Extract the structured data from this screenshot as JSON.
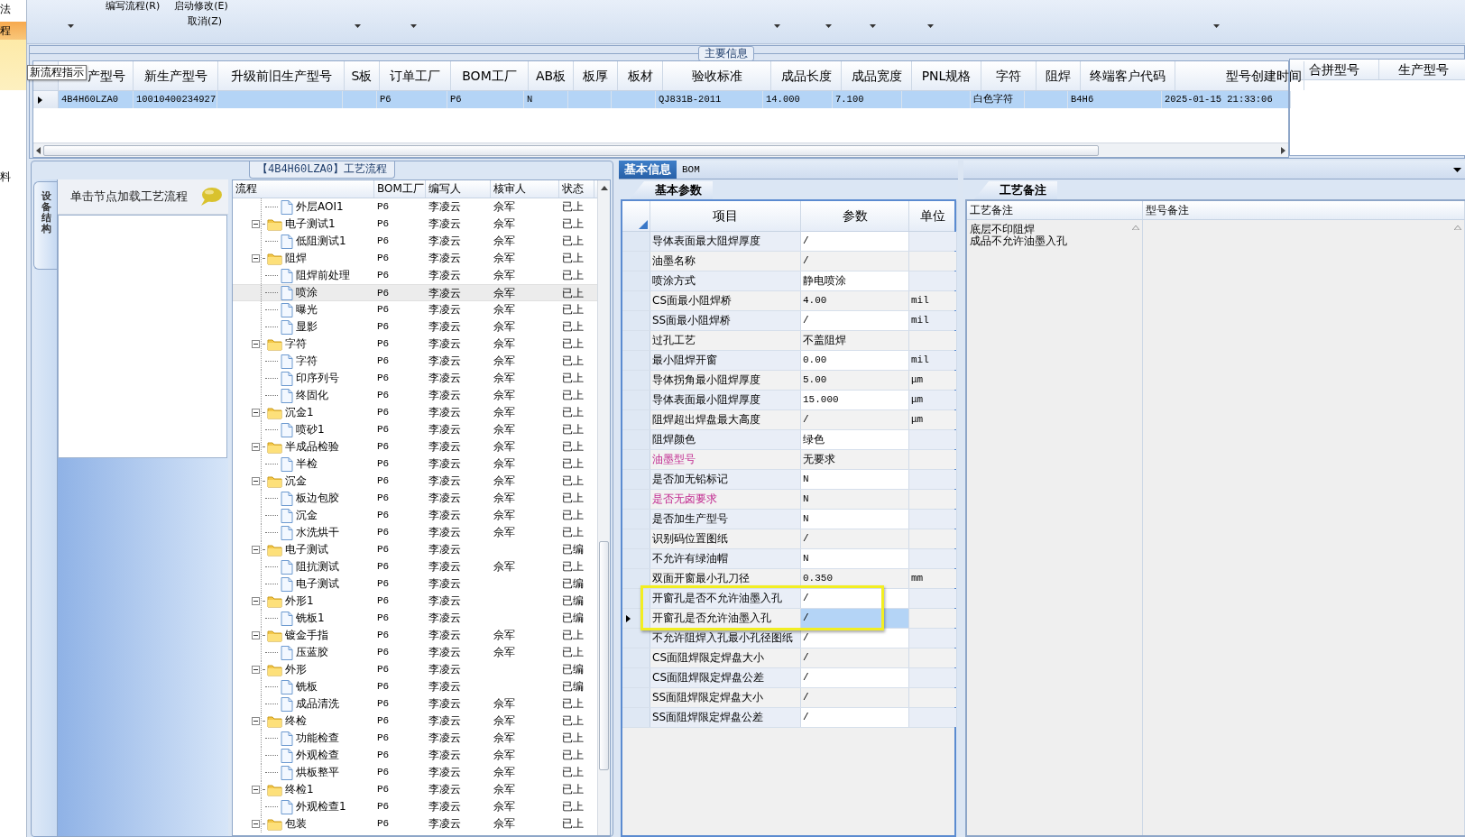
{
  "side_menu": {
    "items": [
      {
        "label": "法",
        "selected": false
      },
      {
        "label": "程",
        "selected": true
      },
      {
        "label": "料",
        "selected": false
      }
    ]
  },
  "toolbar": {
    "items": [
      "编写流程(R)",
      "启动修改(E)"
    ],
    "second_row": [
      "取消(Z)"
    ]
  },
  "main_info": {
    "title": "主要信息",
    "tooltip": "新流程指示",
    "columns": [
      {
        "header": "产型号",
        "value": "4B4H60LZA0"
      },
      {
        "header": "新生产型号",
        "value": "10010400234927"
      },
      {
        "header": "升级前旧生产型号"
      },
      {
        "header": "S板"
      },
      {
        "header": "订单工厂",
        "value": "P6"
      },
      {
        "header": "BOM工厂",
        "value": "P6"
      },
      {
        "header": "AB板",
        "value": "N"
      },
      {
        "header": "板厚"
      },
      {
        "header": "板材"
      },
      {
        "header": "验收标准",
        "value": "QJ831B-2011"
      },
      {
        "header": "成品长度",
        "value": "14.000"
      },
      {
        "header": "成品宽度",
        "value": "7.100"
      },
      {
        "header": "PNL规格"
      },
      {
        "header": "字符",
        "value": "白色字符"
      },
      {
        "header": "阻焊"
      },
      {
        "header": "终端客户代码",
        "value": "B4H6"
      },
      {
        "header": "型号创建时间",
        "value": "2025-01-15 21:33:06"
      }
    ],
    "row_selected": true,
    "side_columns": [
      "合拼型号",
      "生产型号"
    ]
  },
  "process": {
    "title": "【4B4H60LZA0】工艺流程",
    "nav": {
      "tab": {
        "label": "设备结构",
        "selected": true
      },
      "hint": "单击节点加载工艺流程"
    },
    "tree": {
      "columns": [
        "流程",
        "BOM工厂",
        "编写人",
        "核审人",
        "状态"
      ],
      "nodes": [
        {
          "children": [
            {
              "kind": "step",
              "name": "外层AOI1",
              "bom": "P6",
              "writer": "李凌云",
              "reviewer": "佘军",
              "status": "已上",
              "selected": false
            }
          ]
        },
        {
          "kind": "folder",
          "name": "电子测试1",
          "bom": "P6",
          "writer": "李凌云",
          "reviewer": "佘军",
          "status": "已上",
          "selected": false,
          "expanded": true,
          "children": [
            {
              "kind": "step",
              "name": "低阻测试1",
              "bom": "P6",
              "writer": "李凌云",
              "reviewer": "佘军",
              "status": "已上",
              "selected": false
            }
          ]
        },
        {
          "kind": "folder",
          "name": "阻焊",
          "bom": "P6",
          "writer": "李凌云",
          "reviewer": "佘军",
          "status": "已上",
          "selected": false,
          "expanded": true,
          "children": [
            {
              "kind": "step",
              "name": "阻焊前处理",
              "bom": "P6",
              "writer": "李凌云",
              "reviewer": "佘军",
              "status": "已上",
              "selected": false
            },
            {
              "kind": "step",
              "name": "喷涂",
              "bom": "P6",
              "writer": "李凌云",
              "reviewer": "佘军",
              "status": "已上",
              "selected": true
            },
            {
              "kind": "step",
              "name": "曝光",
              "bom": "P6",
              "writer": "李凌云",
              "reviewer": "佘军",
              "status": "已上",
              "selected": false
            },
            {
              "kind": "step",
              "name": "显影",
              "bom": "P6",
              "writer": "李凌云",
              "reviewer": "佘军",
              "status": "已上",
              "selected": false
            }
          ]
        },
        {
          "kind": "folder",
          "name": "字符",
          "bom": "P6",
          "writer": "李凌云",
          "reviewer": "佘军",
          "status": "已上",
          "selected": false,
          "expanded": true,
          "children": [
            {
              "kind": "step",
              "name": "字符",
              "bom": "P6",
              "writer": "李凌云",
              "reviewer": "佘军",
              "status": "已上",
              "selected": false
            },
            {
              "kind": "step",
              "name": "印序列号",
              "bom": "P6",
              "writer": "李凌云",
              "reviewer": "佘军",
              "status": "已上",
              "selected": false
            },
            {
              "kind": "step",
              "name": "终固化",
              "bom": "P6",
              "writer": "李凌云",
              "reviewer": "佘军",
              "status": "已上",
              "selected": false
            }
          ]
        },
        {
          "kind": "folder",
          "name": "沉金1",
          "bom": "P6",
          "writer": "李凌云",
          "reviewer": "佘军",
          "status": "已上",
          "selected": false,
          "expanded": true,
          "children": [
            {
              "kind": "step",
              "name": "喷砂1",
              "bom": "P6",
              "writer": "李凌云",
              "reviewer": "佘军",
              "status": "已上",
              "selected": false
            }
          ]
        },
        {
          "kind": "folder",
          "name": "半成品检验",
          "bom": "P6",
          "writer": "李凌云",
          "reviewer": "佘军",
          "status": "已上",
          "selected": false,
          "expanded": true,
          "children": [
            {
              "kind": "step",
              "name": "半检",
              "bom": "P6",
              "writer": "李凌云",
              "reviewer": "佘军",
              "status": "已上",
              "selected": false
            }
          ]
        },
        {
          "kind": "folder",
          "name": "沉金",
          "bom": "P6",
          "writer": "李凌云",
          "reviewer": "佘军",
          "status": "已上",
          "selected": false,
          "expanded": true,
          "children": [
            {
              "kind": "step",
              "name": "板边包胶",
              "bom": "P6",
              "writer": "李凌云",
              "reviewer": "佘军",
              "status": "已上",
              "selected": false
            },
            {
              "kind": "step",
              "name": "沉金",
              "bom": "P6",
              "writer": "李凌云",
              "reviewer": "佘军",
              "status": "已上",
              "selected": false
            },
            {
              "kind": "step",
              "name": "水洗烘干",
              "bom": "P6",
              "writer": "李凌云",
              "reviewer": "佘军",
              "status": "已上",
              "selected": false
            }
          ]
        },
        {
          "kind": "folder",
          "name": "电子测试",
          "bom": "P6",
          "writer": "李凌云",
          "status": "已编",
          "selected": false,
          "expanded": true,
          "children": [
            {
              "kind": "step",
              "name": "阻抗测试",
              "bom": "P6",
              "writer": "李凌云",
              "reviewer": "佘军",
              "status": "已上",
              "selected": false
            },
            {
              "kind": "step",
              "name": "电子测试",
              "bom": "P6",
              "writer": "李凌云",
              "status": "已编",
              "selected": false
            }
          ]
        },
        {
          "kind": "folder",
          "name": "外形1",
          "bom": "P6",
          "writer": "李凌云",
          "status": "已编",
          "selected": false,
          "expanded": true,
          "children": [
            {
              "kind": "step",
              "name": "铣板1",
              "bom": "P6",
              "writer": "李凌云",
              "status": "已编",
              "selected": false
            }
          ]
        },
        {
          "kind": "folder",
          "name": "镀金手指",
          "bom": "P6",
          "writer": "李凌云",
          "reviewer": "佘军",
          "status": "已上",
          "selected": false,
          "expanded": true,
          "children": [
            {
              "kind": "step",
              "name": "压蓝胶",
              "bom": "P6",
              "writer": "李凌云",
              "reviewer": "佘军",
              "status": "已上",
              "selected": false
            }
          ]
        },
        {
          "kind": "folder",
          "name": "外形",
          "bom": "P6",
          "writer": "李凌云",
          "status": "已编",
          "selected": false,
          "expanded": true,
          "children": [
            {
              "kind": "step",
              "name": "铣板",
              "bom": "P6",
              "writer": "李凌云",
              "status": "已编",
              "selected": false
            },
            {
              "kind": "step",
              "name": "成品清洗",
              "bom": "P6",
              "writer": "李凌云",
              "reviewer": "佘军",
              "status": "已上",
              "selected": false
            }
          ]
        },
        {
          "kind": "folder",
          "name": "终检",
          "bom": "P6",
          "writer": "李凌云",
          "reviewer": "佘军",
          "status": "已上",
          "selected": false,
          "expanded": true,
          "children": [
            {
              "kind": "step",
              "name": "功能检查",
              "bom": "P6",
              "writer": "李凌云",
              "reviewer": "佘军",
              "status": "已上",
              "selected": false
            },
            {
              "kind": "step",
              "name": "外观检查",
              "bom": "P6",
              "writer": "李凌云",
              "reviewer": "佘军",
              "status": "已上",
              "selected": false
            },
            {
              "kind": "step",
              "name": "烘板整平",
              "bom": "P6",
              "writer": "李凌云",
              "reviewer": "佘军",
              "status": "已上",
              "selected": false
            }
          ]
        },
        {
          "kind": "folder",
          "name": "终检1",
          "bom": "P6",
          "writer": "李凌云",
          "reviewer": "佘军",
          "status": "已上",
          "selected": false,
          "expanded": true,
          "children": [
            {
              "kind": "step",
              "name": "外观检查1",
              "bom": "P6",
              "writer": "李凌云",
              "reviewer": "佘军",
              "status": "已上",
              "selected": false
            }
          ]
        },
        {
          "kind": "folder",
          "name": "包装",
          "bom": "P6",
          "writer": "李凌云",
          "reviewer": "佘军",
          "status": "已上",
          "selected": false,
          "expanded": true
        }
      ]
    }
  },
  "params": {
    "tabs": [
      {
        "label": "基本信息",
        "selected": true
      },
      {
        "label": "BOM",
        "selected": false
      }
    ],
    "subtabs": [
      {
        "label": "基本参数",
        "selected": true
      }
    ],
    "columns": [
      "项目",
      "参数",
      "单位"
    ],
    "rows": [
      {
        "item": "导体表面最大阻焊厚度",
        "value": "/",
        "required": false,
        "selected": false,
        "boxed": false
      },
      {
        "item": "油墨名称",
        "value": "/",
        "required": false,
        "selected": false,
        "boxed": false
      },
      {
        "item": "喷涂方式",
        "value": "静电喷涂",
        "required": false,
        "selected": false,
        "boxed": false
      },
      {
        "item": "CS面最小阻焊桥",
        "value": "4.00",
        "unit": "mil",
        "required": false,
        "selected": false,
        "boxed": false
      },
      {
        "item": "SS面最小阻焊桥",
        "value": "/",
        "unit": "mil",
        "required": false,
        "selected": false,
        "boxed": false
      },
      {
        "item": "过孔工艺",
        "value": "不盖阻焊",
        "required": false,
        "selected": false,
        "boxed": false
      },
      {
        "item": "最小阻焊开窗",
        "value": "0.00",
        "unit": "mil",
        "required": false,
        "selected": false,
        "boxed": false
      },
      {
        "item": "导体拐角最小阻焊厚度",
        "value": "5.00",
        "unit": "μm",
        "required": false,
        "selected": false,
        "boxed": false
      },
      {
        "item": "导体表面最小阻焊厚度",
        "value": "15.000",
        "unit": "μm",
        "required": false,
        "selected": false,
        "boxed": false
      },
      {
        "item": "阻焊超出焊盘最大高度",
        "value": "/",
        "unit": "μm",
        "required": false,
        "selected": false,
        "boxed": false
      },
      {
        "item": "阻焊颜色",
        "value": "绿色",
        "required": false,
        "selected": false,
        "boxed": false
      },
      {
        "item": "油墨型号",
        "value": "无要求",
        "required": true,
        "selected": false,
        "boxed": false
      },
      {
        "item": "是否加无铅标记",
        "value": "N",
        "required": false,
        "selected": false,
        "boxed": false
      },
      {
        "item": "是否无卤要求",
        "value": "N",
        "required": true,
        "selected": false,
        "boxed": false
      },
      {
        "item": "是否加生产型号",
        "value": "N",
        "required": false,
        "selected": false,
        "boxed": false
      },
      {
        "item": "识别码位置图纸",
        "value": "/",
        "required": false,
        "selected": false,
        "boxed": false
      },
      {
        "item": "不允许有绿油帽",
        "value": "N",
        "required": false,
        "selected": false,
        "boxed": false
      },
      {
        "item": "双面开窗最小孔刀径",
        "value": "0.350",
        "unit": "mm",
        "required": false,
        "selected": false,
        "boxed": false
      },
      {
        "item": "开窗孔是否不允许油墨入孔",
        "value": "/",
        "required": false,
        "selected": false,
        "boxed": true
      },
      {
        "item": "开窗孔是否允许油墨入孔",
        "value": "/",
        "required": false,
        "selected": true,
        "boxed": true
      },
      {
        "item": "不允许阻焊入孔最小孔径图纸",
        "value": "/",
        "required": false,
        "selected": false,
        "boxed": false
      },
      {
        "item": "CS面阻焊限定焊盘大小",
        "value": "/",
        "required": false,
        "selected": false,
        "boxed": false
      },
      {
        "item": "CS面阻焊限定焊盘公差",
        "value": "/",
        "required": false,
        "selected": false,
        "boxed": false
      },
      {
        "item": "SS面阻焊限定焊盘大小",
        "value": "/",
        "required": false,
        "selected": false,
        "boxed": false
      },
      {
        "item": "SS面阻焊限定焊盘公差",
        "value": "/",
        "required": false,
        "selected": false,
        "boxed": false
      }
    ]
  },
  "notes": {
    "tabs": [
      {
        "label": "工艺备注",
        "selected": true
      }
    ],
    "columns": [
      "工艺备注",
      "型号备注"
    ],
    "process_notes": [
      "底层不印阻焊",
      "成品不允许油墨入孔"
    ]
  }
}
